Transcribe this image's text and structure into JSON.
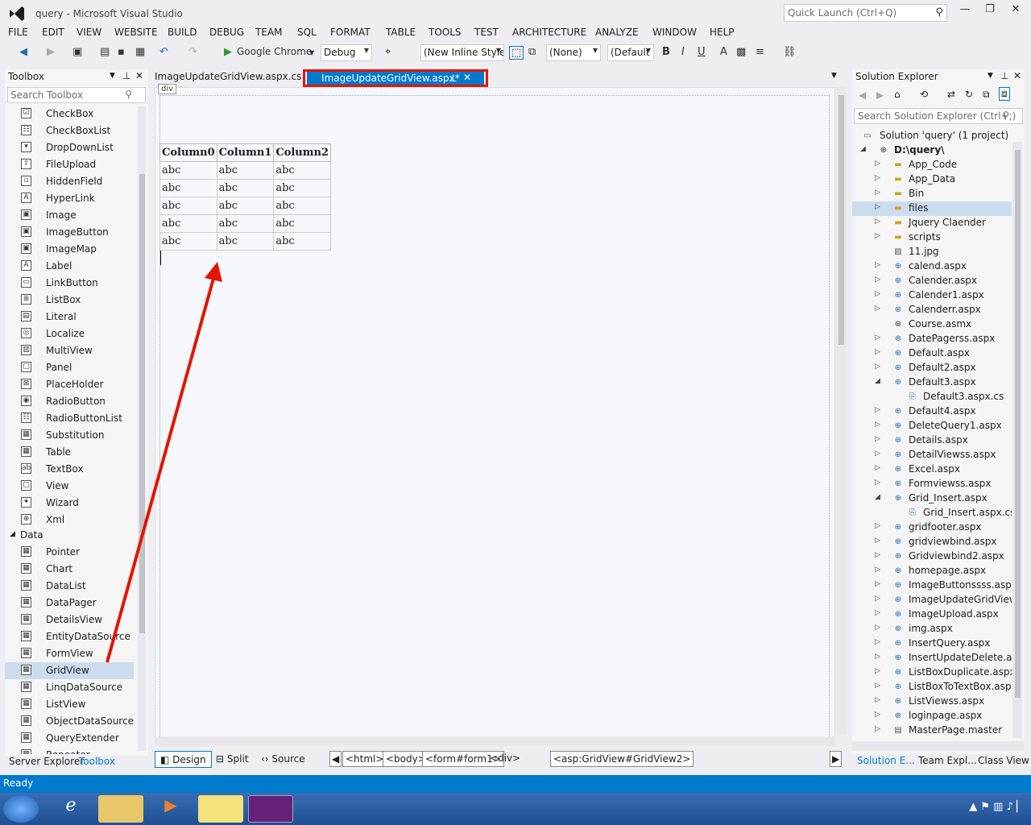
{
  "window": {
    "title": "query - Microsoft Visual Studio",
    "quick_launch_placeholder": "Quick Launch (Ctrl+Q)"
  },
  "menu": [
    "FILE",
    "EDIT",
    "VIEW",
    "WEBSITE",
    "BUILD",
    "DEBUG",
    "TEAM",
    "SQL",
    "FORMAT",
    "TABLE",
    "TOOLS",
    "TEST",
    "ARCHITECTURE",
    "ANALYZE",
    "WINDOW",
    "HELP"
  ],
  "toolbar": {
    "run_target": "Google Chrome",
    "config": "Debug",
    "style_target": "(New Inline Style",
    "style_none": "(None)",
    "font_default": "(Default",
    "bold": "B",
    "italic": "I",
    "underline": "U"
  },
  "toolbox": {
    "title": "Toolbox",
    "search_placeholder": "Search Toolbox",
    "items": [
      "CheckBox",
      "CheckBoxList",
      "DropDownList",
      "FileUpload",
      "HiddenField",
      "HyperLink",
      "Image",
      "ImageButton",
      "ImageMap",
      "Label",
      "LinkButton",
      "ListBox",
      "Literal",
      "Localize",
      "MultiView",
      "Panel",
      "PlaceHolder",
      "RadioButton",
      "RadioButtonList",
      "Substitution",
      "Table",
      "TextBox",
      "View",
      "Wizard",
      "Xml"
    ],
    "data_group": "Data",
    "data_items": [
      "Pointer",
      "Chart",
      "DataList",
      "DataPager",
      "DetailsView",
      "EntityDataSource",
      "FormView",
      "GridView",
      "LinqDataSource",
      "ListView",
      "ObjectDataSource",
      "QueryExtender",
      "Repeater"
    ],
    "selected": "GridView",
    "tabs": {
      "server_explorer": "Server Explorer",
      "toolbox": "Toolbox"
    }
  },
  "editor": {
    "tabs": [
      {
        "label": "ImageUpdateGridView.aspx.cs"
      },
      {
        "label": "ImageUpdateGridView.aspx*"
      }
    ],
    "div_tag": "div",
    "grid": {
      "headers": [
        "Column0",
        "Column1",
        "Column2"
      ],
      "rows": [
        [
          "abc",
          "abc",
          "abc"
        ],
        [
          "abc",
          "abc",
          "abc"
        ],
        [
          "abc",
          "abc",
          "abc"
        ],
        [
          "abc",
          "abc",
          "abc"
        ],
        [
          "abc",
          "abc",
          "abc"
        ]
      ]
    },
    "views": {
      "design": "Design",
      "split": "Split",
      "source": "Source"
    },
    "breadcrumbs": [
      "<html>",
      "<body>",
      "<form#form1>",
      "<div>",
      "<asp:GridView#GridView2>"
    ]
  },
  "solution_explorer": {
    "title": "Solution Explorer",
    "search_placeholder": "Search Solution Explorer (Ctrl+;)",
    "solution": "Solution 'query' (1 project)",
    "project": "D:\\query\\",
    "items": [
      {
        "name": "App_Code",
        "type": "folder",
        "exp": "▷",
        "indent": 1
      },
      {
        "name": "App_Data",
        "type": "folder",
        "exp": "▷",
        "indent": 1
      },
      {
        "name": "Bin",
        "type": "folder",
        "exp": "▷",
        "indent": 1
      },
      {
        "name": "files",
        "type": "folder",
        "exp": "▷",
        "indent": 1,
        "sel": true
      },
      {
        "name": "Jquery Claender",
        "type": "folder",
        "exp": "▷",
        "indent": 1
      },
      {
        "name": "scripts",
        "type": "folder",
        "exp": "▷",
        "indent": 1
      },
      {
        "name": "11.jpg",
        "type": "image",
        "exp": "",
        "indent": 1
      },
      {
        "name": "calend.aspx",
        "type": "web",
        "exp": "▷",
        "indent": 1
      },
      {
        "name": "Calender.aspx",
        "type": "web",
        "exp": "▷",
        "indent": 1
      },
      {
        "name": "Calender1.aspx",
        "type": "web",
        "exp": "▷",
        "indent": 1
      },
      {
        "name": "Calenderr.aspx",
        "type": "web",
        "exp": "▷",
        "indent": 1
      },
      {
        "name": "Course.asmx",
        "type": "service",
        "exp": "",
        "indent": 1
      },
      {
        "name": "DatePagerss.aspx",
        "type": "web",
        "exp": "▷",
        "indent": 1
      },
      {
        "name": "Default.aspx",
        "type": "web",
        "exp": "▷",
        "indent": 1
      },
      {
        "name": "Default2.aspx",
        "type": "web",
        "exp": "▷",
        "indent": 1
      },
      {
        "name": "Default3.aspx",
        "type": "web",
        "exp": "◢",
        "indent": 1
      },
      {
        "name": "Default3.aspx.cs",
        "type": "code",
        "exp": "",
        "indent": 2
      },
      {
        "name": "Default4.aspx",
        "type": "web",
        "exp": "▷",
        "indent": 1
      },
      {
        "name": "DeleteQuery1.aspx",
        "type": "web",
        "exp": "▷",
        "indent": 1
      },
      {
        "name": "Details.aspx",
        "type": "web",
        "exp": "▷",
        "indent": 1
      },
      {
        "name": "DetailViewss.aspx",
        "type": "web",
        "exp": "▷",
        "indent": 1
      },
      {
        "name": "Excel.aspx",
        "type": "web",
        "exp": "▷",
        "indent": 1
      },
      {
        "name": "Formviewss.aspx",
        "type": "web",
        "exp": "▷",
        "indent": 1
      },
      {
        "name": "Grid_Insert.aspx",
        "type": "web",
        "exp": "◢",
        "indent": 1
      },
      {
        "name": "Grid_Insert.aspx.cs",
        "type": "code",
        "exp": "",
        "indent": 2
      },
      {
        "name": "gridfooter.aspx",
        "type": "web",
        "exp": "▷",
        "indent": 1
      },
      {
        "name": "gridviewbind.aspx",
        "type": "web",
        "exp": "▷",
        "indent": 1
      },
      {
        "name": "Gridviewbind2.aspx",
        "type": "web",
        "exp": "▷",
        "indent": 1
      },
      {
        "name": "homepage.aspx",
        "type": "web",
        "exp": "▷",
        "indent": 1
      },
      {
        "name": "ImageButtonssss.aspx",
        "type": "web",
        "exp": "▷",
        "indent": 1
      },
      {
        "name": "ImageUpdateGridView.as",
        "type": "web",
        "exp": "▷",
        "indent": 1
      },
      {
        "name": "ImageUpload.aspx",
        "type": "web",
        "exp": "▷",
        "indent": 1
      },
      {
        "name": "img.aspx",
        "type": "web",
        "exp": "▷",
        "indent": 1
      },
      {
        "name": "InsertQuery.aspx",
        "type": "web",
        "exp": "▷",
        "indent": 1
      },
      {
        "name": "InsertUpdateDelete.aspx",
        "type": "web",
        "exp": "▷",
        "indent": 1
      },
      {
        "name": "ListBoxDuplicate.aspx",
        "type": "web",
        "exp": "▷",
        "indent": 1
      },
      {
        "name": "ListBoxToTextBox.aspx",
        "type": "web",
        "exp": "▷",
        "indent": 1
      },
      {
        "name": "ListViewss.aspx",
        "type": "web",
        "exp": "▷",
        "indent": 1
      },
      {
        "name": "loginpage.aspx",
        "type": "web",
        "exp": "▷",
        "indent": 1
      },
      {
        "name": "MasterPage.master",
        "type": "master",
        "exp": "▷",
        "indent": 1
      }
    ],
    "tabs": {
      "solution": "Solution E...",
      "team": "Team Expl...",
      "class_view": "Class View"
    }
  },
  "status": {
    "text": "Ready"
  },
  "colors": {
    "accent": "#007acc",
    "highlight": "#e51400",
    "selection": "#ccdcef"
  }
}
